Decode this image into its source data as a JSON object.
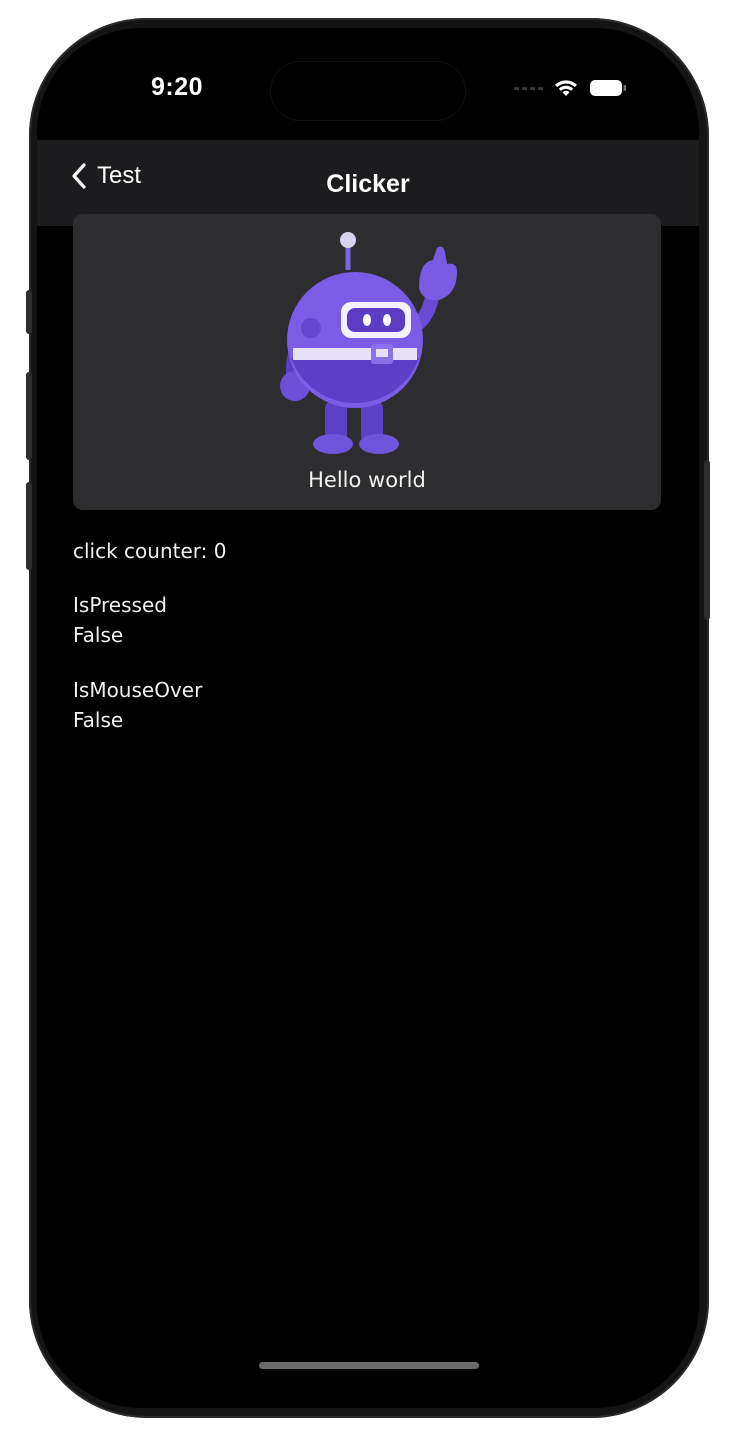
{
  "status_bar": {
    "time": "9:20"
  },
  "nav": {
    "back_label": "Test",
    "title": "Clicker"
  },
  "card": {
    "label": "Hello world",
    "image_icon": "dotnet-bot-icon"
  },
  "info": {
    "click_counter": "click counter: 0",
    "is_pressed_label": "IsPressed",
    "is_pressed_value": "False",
    "is_mouse_over_label": "IsMouseOver",
    "is_mouse_over_value": "False"
  },
  "colors": {
    "background": "#000000",
    "nav_bar": "#1c1c1e",
    "card": "#2d2d2f",
    "bot_purple": "#6f4fd9",
    "text": "#f0f0f0"
  }
}
